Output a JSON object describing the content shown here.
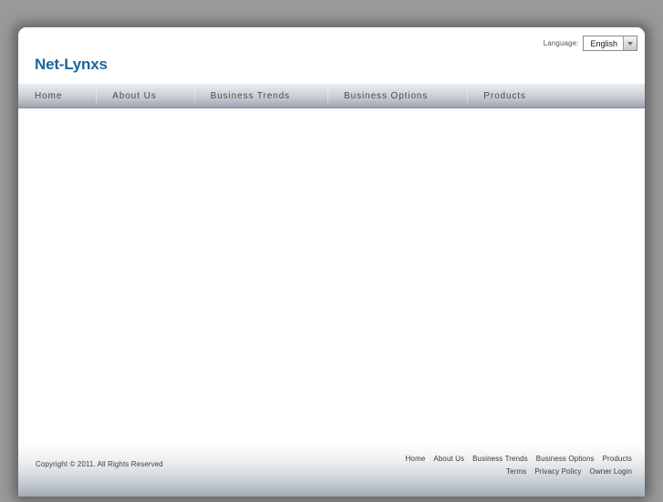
{
  "colors": {
    "page_background": "#999999",
    "container_background": "#ffffff",
    "logo_blue": "#1a6599",
    "nav_text": "#4a4a4a",
    "footer_text": "#3a3a3a",
    "nav_gradient_top": "#eceef0",
    "nav_gradient_bottom": "#9aa1ac"
  },
  "header": {
    "logo": "Net-Lynxs",
    "language": {
      "label": "Language:",
      "selected": "English",
      "arrow_icon": "chevron-down-icon"
    }
  },
  "nav": {
    "items": [
      {
        "label": "Home"
      },
      {
        "label": "About Us"
      },
      {
        "label": "Business Trends"
      },
      {
        "label": "Business Options"
      },
      {
        "label": "Products"
      }
    ]
  },
  "content": {
    "body_text": ""
  },
  "footer": {
    "copyright": "Copyright © 2011. All Rights Reserved",
    "link_rows": [
      [
        {
          "label": "Home"
        },
        {
          "label": "About Us"
        },
        {
          "label": "Business Trends"
        },
        {
          "label": "Business Options"
        },
        {
          "label": "Products"
        }
      ],
      [
        {
          "label": "Terms"
        },
        {
          "label": "Privacy Policy"
        },
        {
          "label": "Owner Login"
        }
      ]
    ]
  }
}
